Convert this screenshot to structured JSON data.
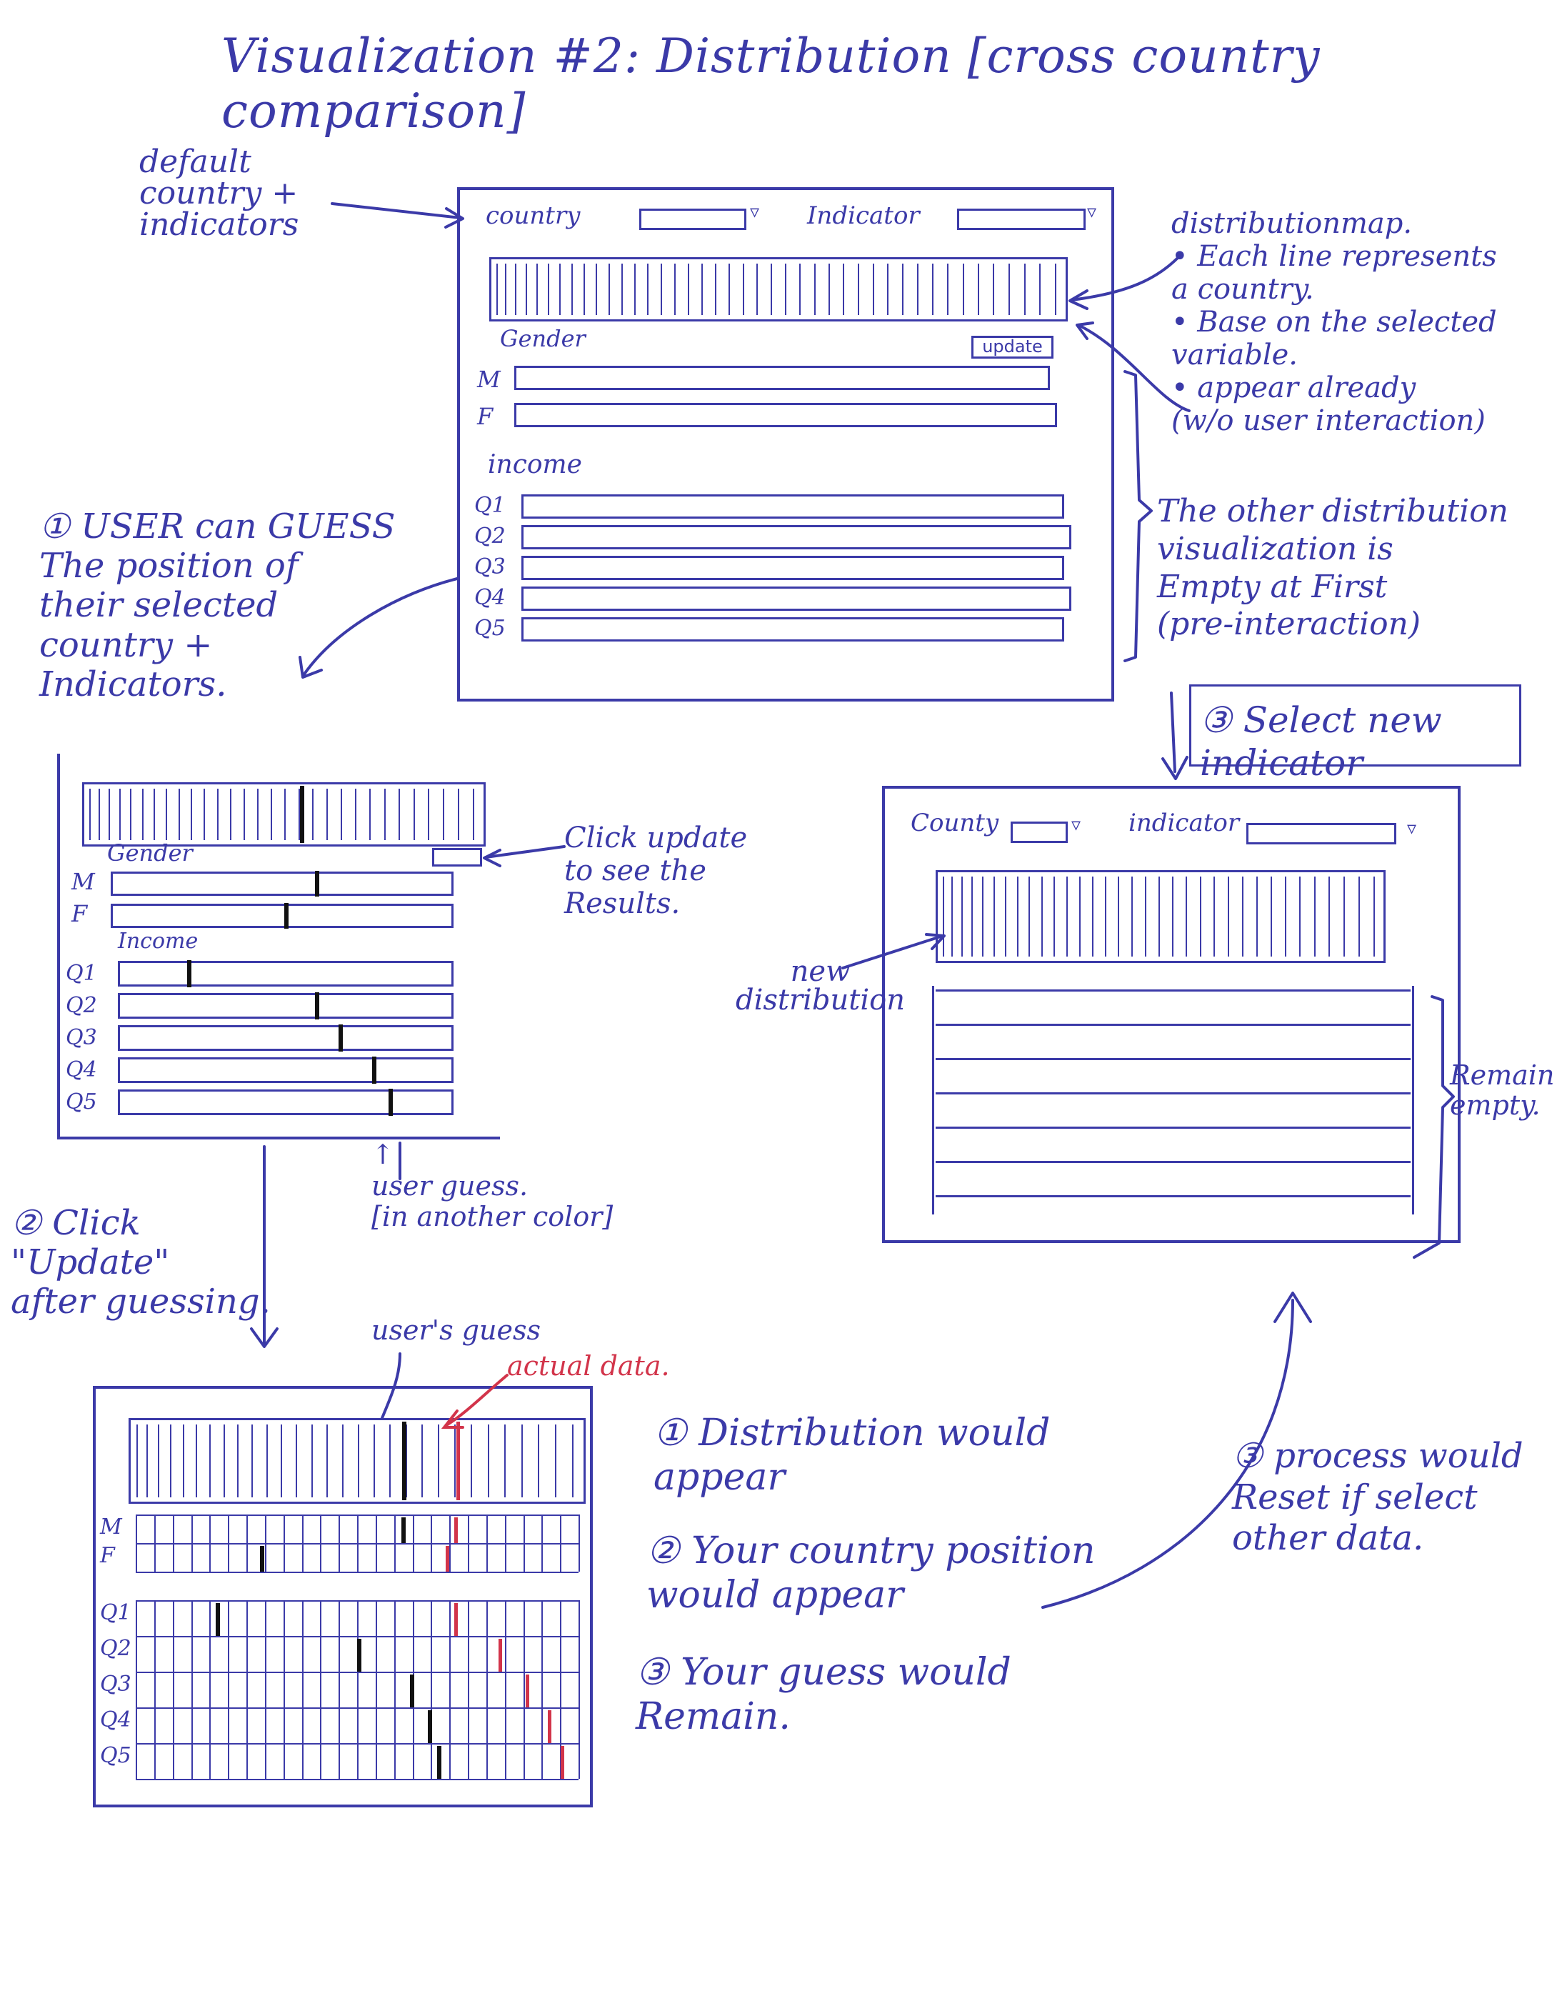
{
  "title": "Visualization #2: Distribution [cross country comparison]",
  "annotations": {
    "default": "default\ncountry +\nindicators",
    "distribution_map": "distributionmap.\n• Each line represents\n  a country.\n• Base on the selected\n  variable.\n• appear already\n  (w/o user interaction)",
    "other_empty": "The other distribution\nvisualization is\nEmpty at First\n(pre-interaction)",
    "step1": "① USER can GUESS\nThe position of\ntheir selected\ncountry +\nIndicators.",
    "click_update": "Click update\nto see the\nResults.",
    "user_guess_color": "↑\nuser guess.\n[in another color]",
    "step2": "② Click\n\"Update\"\nafter guessing.",
    "step3_select": "③ Select new indicator",
    "new_distribution": "new\ndistribution",
    "remain_empty": "Remain\nempty.",
    "users_guess": "user's guess",
    "actual_data": "actual data.",
    "result1": "① Distribution would\nappear",
    "result2": "② Your country position\nwould appear",
    "result3": "③ Your guess would\nRemain.",
    "reset": "③ process would\nReset if select\nother data."
  },
  "sketch1": {
    "country_label": "country",
    "indicator_label": "Indicator",
    "gender_label": "Gender",
    "update_label": "update",
    "gender_rows": [
      "M",
      "F"
    ],
    "income_label": "income",
    "income_rows": [
      "Q1",
      "Q2",
      "Q3",
      "Q4",
      "Q5"
    ]
  },
  "sketch2": {
    "gender_label": "Gender",
    "gender_rows": [
      "M",
      "F"
    ],
    "income_label": "Income",
    "income_rows": [
      "Q1",
      "Q2",
      "Q3",
      "Q4",
      "Q5"
    ]
  },
  "sketch3": {
    "country_label": "County",
    "indicator_label": "indicator"
  },
  "sketch4": {
    "gender_rows": [
      "M",
      "F"
    ],
    "income_rows": [
      "Q1",
      "Q2",
      "Q3",
      "Q4",
      "Q5"
    ]
  },
  "colors": {
    "ink": "#3b3aa8",
    "guess": "#111111",
    "actual": "#d2344a"
  }
}
